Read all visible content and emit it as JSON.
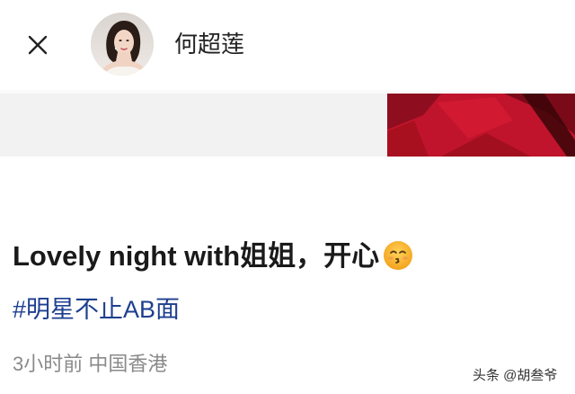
{
  "header": {
    "close_icon": "close-icon",
    "avatar": "avatar",
    "username": "何超莲"
  },
  "media": {
    "accent_color": "#c0142c",
    "background_color": "#f2f2f2"
  },
  "post": {
    "text": "Lovely night with姐姐，开心",
    "emoji": "smiling-kissing-face-emoji",
    "hashtag": "#明星不止AB面",
    "meta": "3小时前 中国香港"
  },
  "watermark": {
    "text": "头条 @胡叁爷"
  },
  "colors": {
    "hashtag": "#1d3f8f",
    "meta": "#8a8a8a",
    "text": "#1a1a1a"
  }
}
